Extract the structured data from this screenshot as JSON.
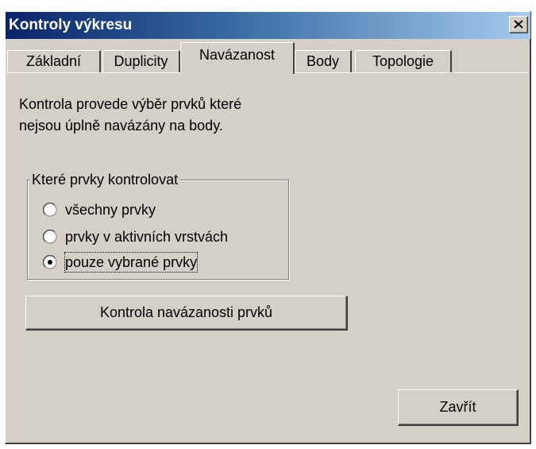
{
  "window": {
    "title": "Kontroly výkresu",
    "colors": {
      "titlebar_start": "#0a246a",
      "titlebar_end": "#a6caf0",
      "face": "#d4d0c8"
    }
  },
  "close_icon": "close-icon",
  "tabs": [
    {
      "label": "Základní",
      "active": false
    },
    {
      "label": "Duplicity",
      "active": false
    },
    {
      "label": "Navázanost",
      "active": true
    },
    {
      "label": "Body",
      "active": false
    },
    {
      "label": "Topologie",
      "active": false
    }
  ],
  "panel": {
    "description": "Kontrola provede výběr prvků které\nnejsou úplně navázány na body.",
    "group": {
      "label": "Které prvky kontrolovat",
      "options": [
        {
          "label": "všechny prvky",
          "checked": false
        },
        {
          "label": "prvky v aktivních vrstvách",
          "checked": false
        },
        {
          "label": "pouze vybrané prvky",
          "checked": true
        }
      ]
    },
    "check_button": "Kontrola navázanosti prvků"
  },
  "footer": {
    "close_button": "Zavřít"
  }
}
